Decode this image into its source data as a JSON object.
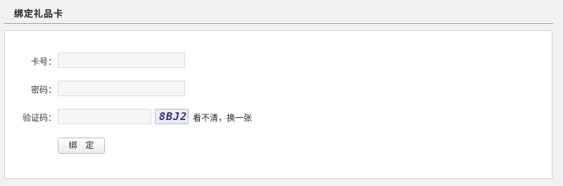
{
  "header": {
    "title": "绑定礼品卡"
  },
  "form": {
    "card_number": {
      "label": "卡号：",
      "value": "",
      "placeholder": ""
    },
    "password": {
      "label": "密码：",
      "value": "",
      "placeholder": ""
    },
    "captcha": {
      "label": "验证码：",
      "value": "",
      "placeholder": "",
      "image_text": "8BJ2",
      "refresh_text": "看不清，换一张"
    },
    "submit_label": "绑 定"
  },
  "colors": {
    "page_background": "#f1f1f1",
    "panel_background": "#ffffff",
    "input_background": "#f7f7f7",
    "captcha_text": "#34307a"
  }
}
